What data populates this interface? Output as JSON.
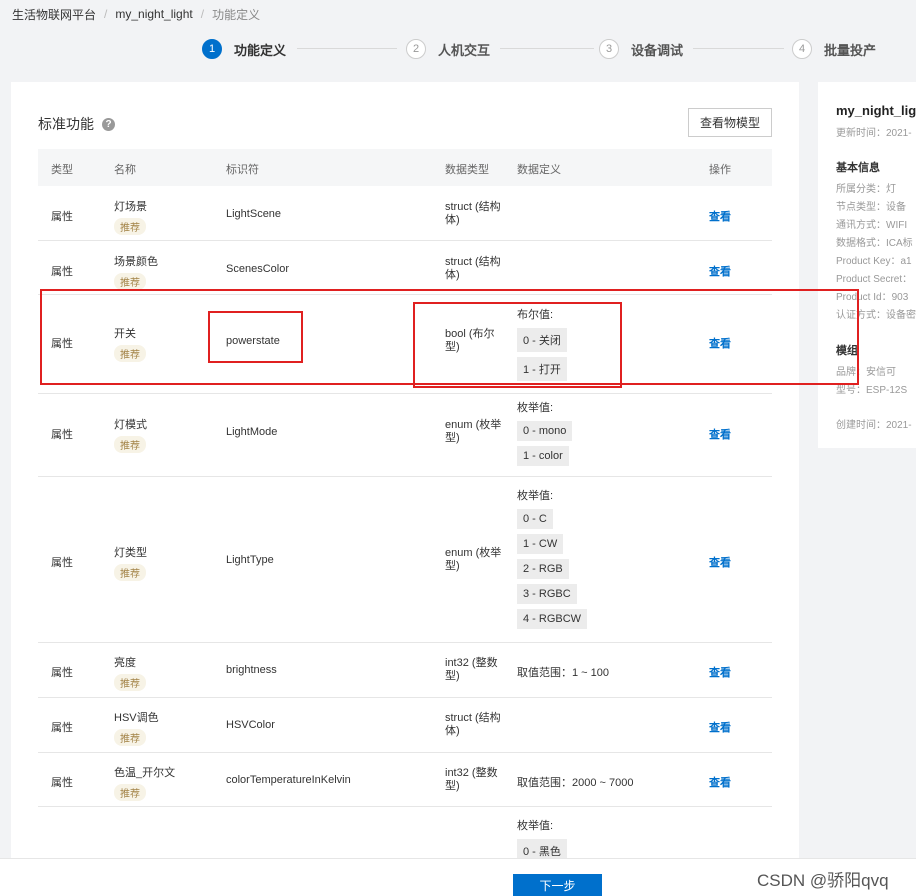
{
  "breadcrumb": {
    "platform": "生活物联网平台",
    "product": "my_night_light",
    "current": "功能定义"
  },
  "steps": [
    {
      "num": "1",
      "label": "功能定义"
    },
    {
      "num": "2",
      "label": "人机交互"
    },
    {
      "num": "3",
      "label": "设备调试"
    },
    {
      "num": "4",
      "label": "批量投产"
    }
  ],
  "panel": {
    "title": "标准功能",
    "help": "?",
    "model_button": "查看物模型"
  },
  "table": {
    "headers": {
      "type": "类型",
      "name": "名称",
      "identifier": "标识符",
      "data_type": "数据类型",
      "definition": "数据定义",
      "action": "操作"
    },
    "tag": "推荐",
    "action_label": "查看",
    "rows": [
      {
        "type": "属性",
        "name": "灯场景",
        "identifier": "LightScene",
        "data_type": "struct (结构体)",
        "def_label": "",
        "chips": []
      },
      {
        "type": "属性",
        "name": "场景颜色",
        "identifier": "ScenesColor",
        "data_type": "struct (结构体)",
        "def_label": "",
        "chips": []
      },
      {
        "type": "属性",
        "name": "开关",
        "identifier": "powerstate",
        "data_type": "bool (布尔型)",
        "def_label": "布尔值:",
        "chips": [
          "0 - 关闭",
          "1 - 打开"
        ]
      },
      {
        "type": "属性",
        "name": "灯模式",
        "identifier": "LightMode",
        "data_type": "enum (枚举型)",
        "def_label": "枚举值:",
        "chips": [
          "0 - mono",
          "1 - color"
        ]
      },
      {
        "type": "属性",
        "name": "灯类型",
        "identifier": "LightType",
        "data_type": "enum (枚举型)",
        "def_label": "枚举值:",
        "chips": [
          "0 - C",
          "1 - CW",
          "2 - RGB",
          "3 - RGBC",
          "4 - RGBCW"
        ]
      },
      {
        "type": "属性",
        "name": "亮度",
        "identifier": "brightness",
        "data_type": "int32 (整数型)",
        "def_label": "取值范围：1 ~ 100",
        "chips": []
      },
      {
        "type": "属性",
        "name": "HSV调色",
        "identifier": "HSVColor",
        "data_type": "struct (结构体)",
        "def_label": "",
        "chips": []
      },
      {
        "type": "属性",
        "name": "色温_开尔文",
        "identifier": "colorTemperatureInKelvin",
        "data_type": "int32 (整数型)",
        "def_label": "取值范围：2000 ~ 7000",
        "chips": []
      },
      {
        "type": "",
        "name": "",
        "identifier": "",
        "data_type": "",
        "def_label": "枚举值:",
        "chips": [
          "0 - 黑色"
        ]
      }
    ]
  },
  "side": {
    "title": "my_night_light",
    "updated": "更新时间：2021-",
    "basic_heading": "基本信息",
    "basic": [
      "所属分类：灯",
      "节点类型：设备",
      "通讯方式：WIFI",
      "数据格式：ICA标",
      "Product Key：a1",
      "Product Secret：",
      "Product Id：903",
      "认证方式：设备密"
    ],
    "module_heading": "模组",
    "module": [
      "品牌：安信可",
      "型号：ESP-12S"
    ],
    "created": "创建时间：2021-"
  },
  "footer": {
    "next": "下一步"
  },
  "watermark": "CSDN @骄阳qvq"
}
